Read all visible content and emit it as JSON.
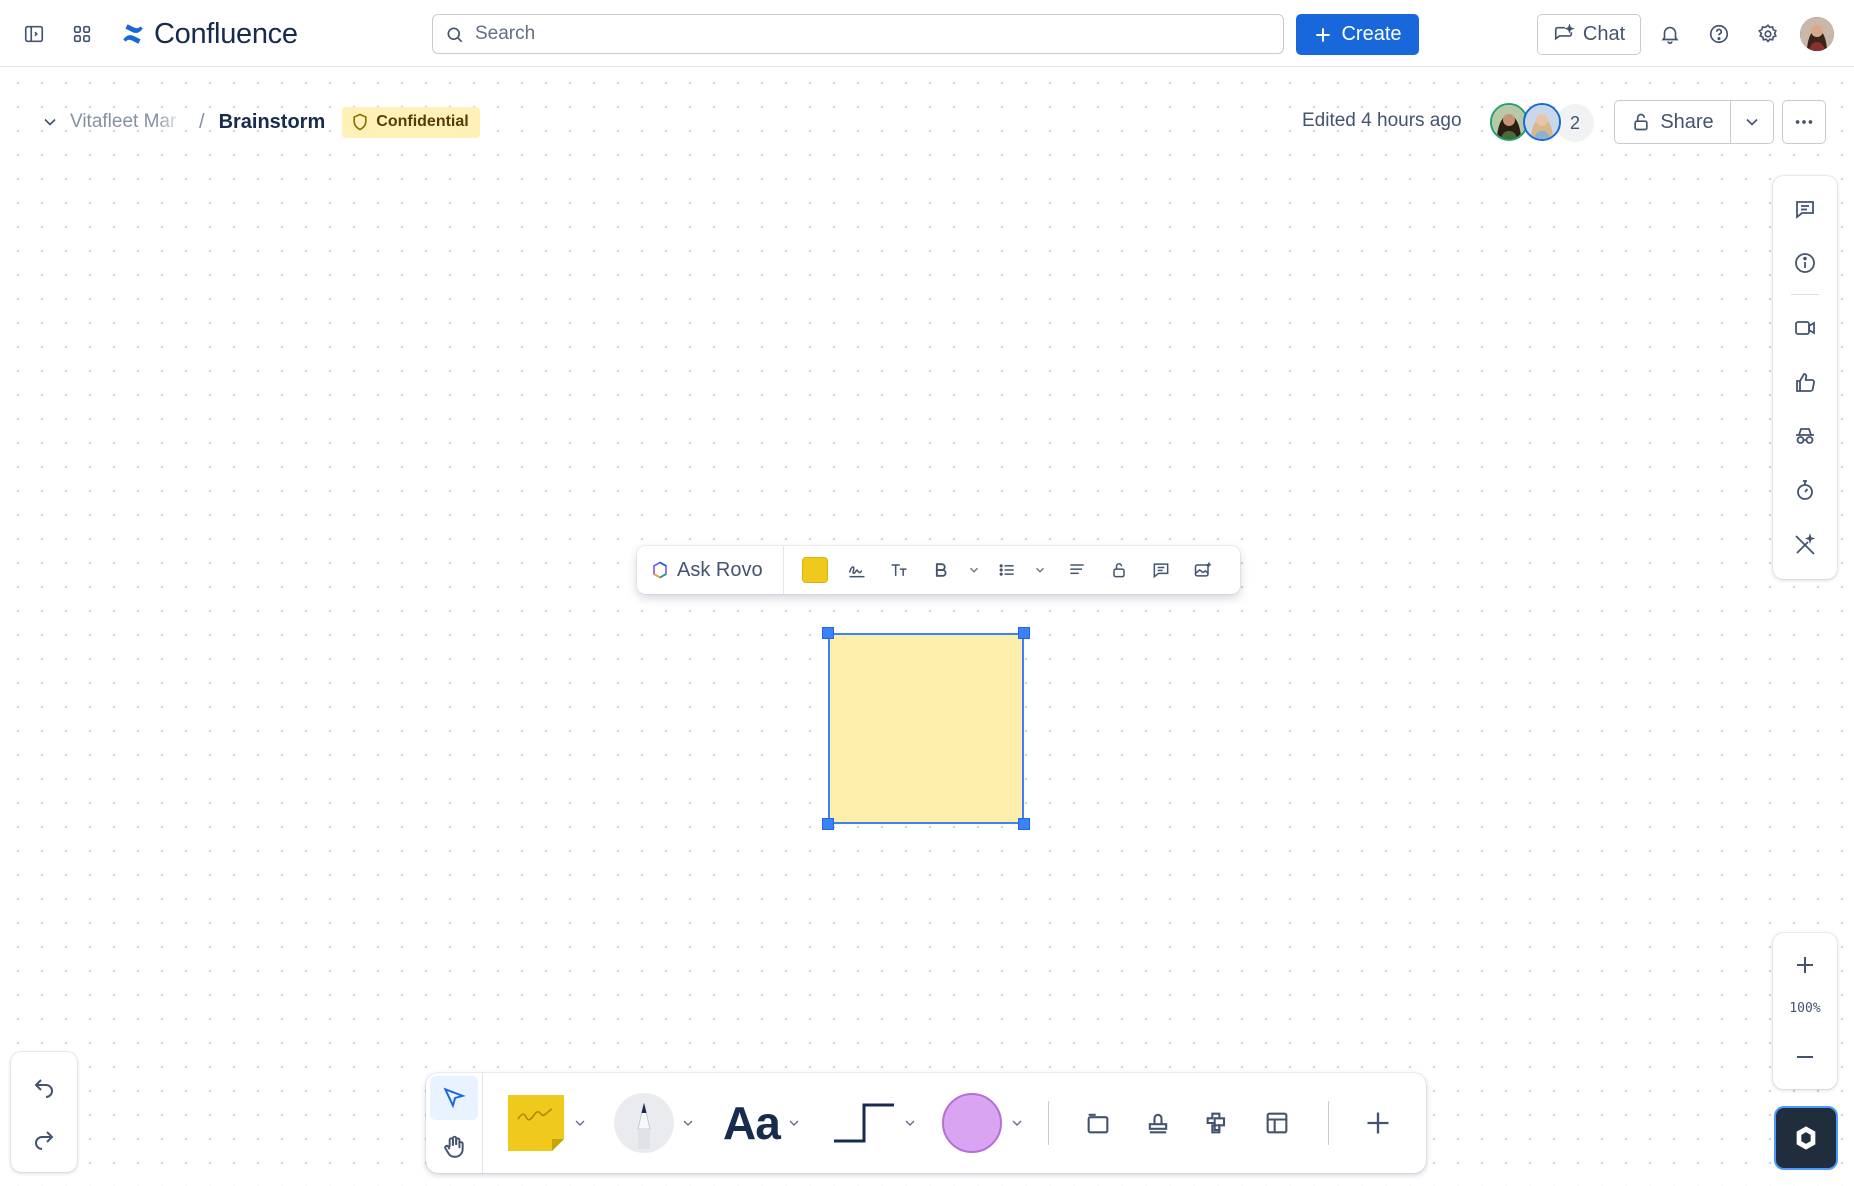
{
  "app": {
    "name": "Confluence"
  },
  "topnav": {
    "search_placeholder": "Search",
    "create_label": "Create",
    "chat_label": "Chat"
  },
  "page": {
    "space": "Vitafleet Mar",
    "title": "Brainstorm",
    "badge": "Confidential",
    "edited": "Edited 4 hours ago",
    "collaborator_count": "2",
    "share_label": "Share"
  },
  "format_toolbar": {
    "ask_rovo_label": "Ask Rovo",
    "note_color": "#f0c91d"
  },
  "zoom": {
    "level": "100%"
  },
  "colors": {
    "accent": "#1868db",
    "sticky_fill": "#fdeeab",
    "selection": "#3b82f6",
    "shape_fill": "#d9a4f2",
    "badge_bg": "#fff1b8"
  },
  "bottom_toolbar": {
    "text_tool_label": "Aa"
  }
}
